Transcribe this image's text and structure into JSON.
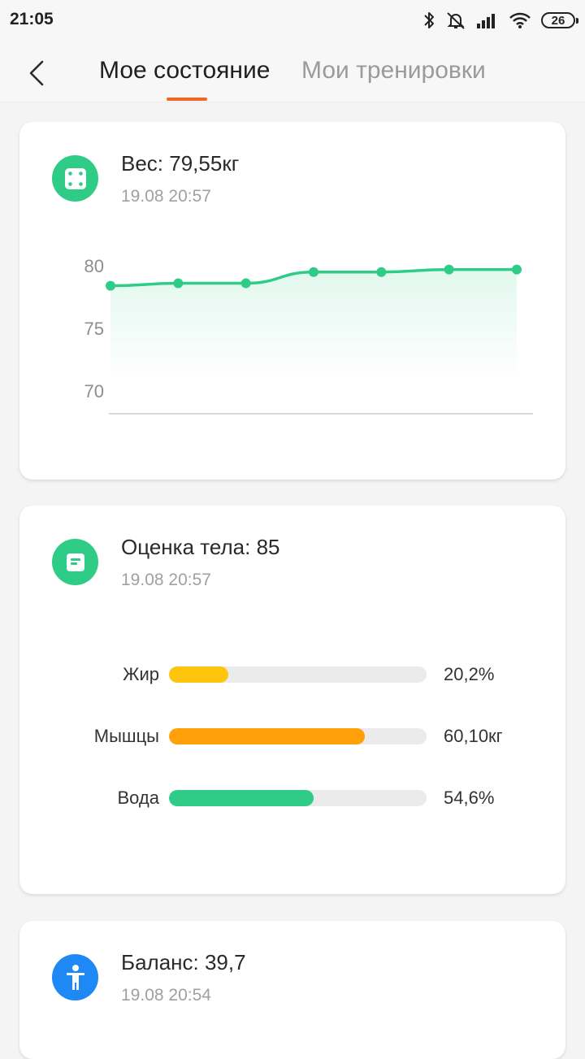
{
  "status_bar": {
    "time": "21:05",
    "battery": "26",
    "icons": [
      "bluetooth-icon",
      "alarm-off-icon",
      "signal-icon",
      "wifi-icon",
      "battery-icon"
    ]
  },
  "header": {
    "tabs": [
      {
        "label": "Мое состояние",
        "active": true
      },
      {
        "label": "Мои тренировки",
        "active": false
      }
    ],
    "accent_color": "#f2671f"
  },
  "cards": {
    "weight": {
      "title": "Вес: 79,55кг",
      "date": "19.08 20:57",
      "icon": "scale-icon",
      "icon_color": "#2ecc87"
    },
    "body_score": {
      "title": "Оценка тела: 85",
      "date": "19.08 20:57",
      "icon": "document-icon",
      "icon_color": "#2ecc87",
      "metrics": [
        {
          "label": "Жир",
          "value": "20,2%",
          "fill": 0.23,
          "color": "#ffc40c"
        },
        {
          "label": "Мышцы",
          "value": "60,10кг",
          "fill": 0.76,
          "color": "#ff9f0a"
        },
        {
          "label": "Вода",
          "value": "54,6%",
          "fill": 0.56,
          "color": "#2ecc87"
        }
      ]
    },
    "balance": {
      "title": "Баланс: 39,7",
      "date": "19.08 20:54",
      "icon": "person-icon",
      "icon_color": "#1e88f5"
    }
  },
  "chart_data": {
    "type": "line",
    "ylim": [
      70,
      80
    ],
    "yticks": [
      "80",
      "75",
      "70"
    ],
    "values": [
      78.4,
      78.6,
      78.6,
      79.5,
      79.5,
      79.7,
      79.7
    ],
    "color": "#2ecc87"
  }
}
